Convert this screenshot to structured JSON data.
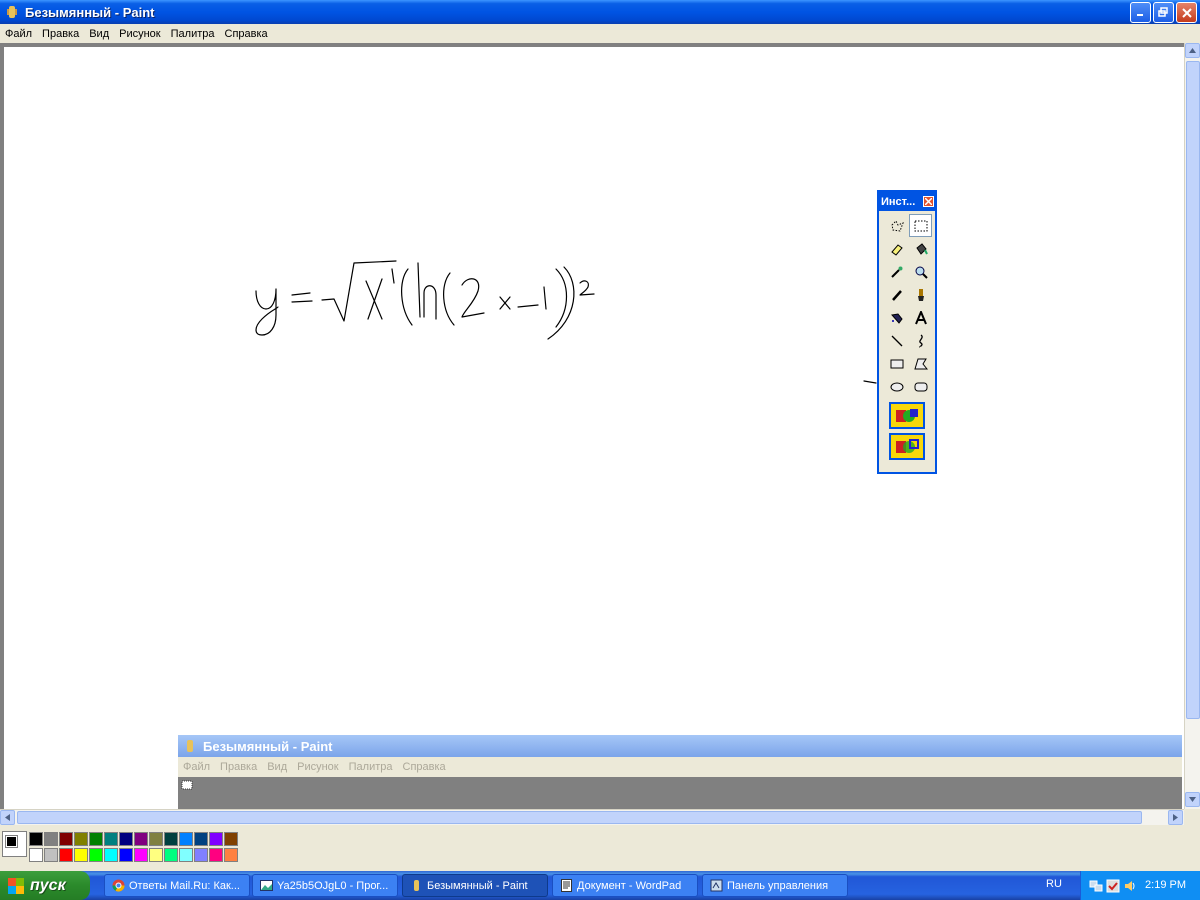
{
  "window": {
    "title": "Безымянный - Paint"
  },
  "menu": [
    "Файл",
    "Правка",
    "Вид",
    "Рисунок",
    "Палитра",
    "Справка"
  ],
  "toolbox": {
    "title": "Инст...",
    "tools": [
      "free-select",
      "rect-select",
      "eraser",
      "fill",
      "eyedropper",
      "magnifier",
      "pencil",
      "brush",
      "airbrush",
      "text",
      "line",
      "curve",
      "rectangle",
      "polygon",
      "ellipse",
      "rounded-rectangle"
    ]
  },
  "second_window": {
    "title": "Безымянный - Paint",
    "menu": [
      "Файл",
      "Правка",
      "Вид",
      "Рисунок",
      "Палитра",
      "Справка"
    ]
  },
  "palette": {
    "row1": [
      "#000000",
      "#808080",
      "#800000",
      "#808000",
      "#008000",
      "#008080",
      "#000080",
      "#800080",
      "#808040",
      "#004040",
      "#0080ff",
      "#004080",
      "#8000ff",
      "#804000"
    ],
    "row2": [
      "#ffffff",
      "#c0c0c0",
      "#ff0000",
      "#ffff00",
      "#00ff00",
      "#00ffff",
      "#0000ff",
      "#ff00ff",
      "#ffff80",
      "#00ff80",
      "#80ffff",
      "#8080ff",
      "#ff0080",
      "#ff8040"
    ]
  },
  "taskbar": {
    "start": "пуск",
    "items": [
      {
        "label": "Ответы Mail.Ru: Как...",
        "icon": "chrome-icon"
      },
      {
        "label": "Ya25b5OJgL0 - Прог...",
        "icon": "image-viewer-icon"
      },
      {
        "label": "Безымянный - Paint",
        "icon": "paint-icon"
      },
      {
        "label": "Документ - WordPad",
        "icon": "wordpad-icon"
      },
      {
        "label": "Панель управления",
        "icon": "control-panel-icon"
      }
    ],
    "language": "RU",
    "clock": "2:19 PM"
  }
}
